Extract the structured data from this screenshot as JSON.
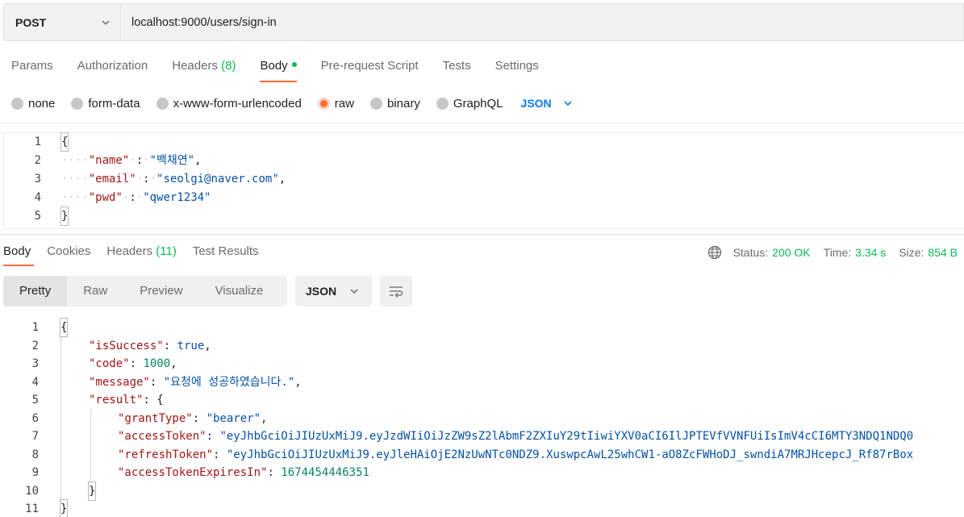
{
  "request": {
    "method": "POST",
    "url": "localhost:9000/users/sign-in"
  },
  "request_tabs": [
    {
      "label": "Params"
    },
    {
      "label": "Authorization"
    },
    {
      "label": "Headers",
      "count": "(8)"
    },
    {
      "label": "Body",
      "active": true
    },
    {
      "label": "Pre-request Script"
    },
    {
      "label": "Tests"
    },
    {
      "label": "Settings"
    }
  ],
  "body_types": [
    {
      "label": "none"
    },
    {
      "label": "form-data"
    },
    {
      "label": "x-www-form-urlencoded"
    },
    {
      "label": "raw",
      "selected": true
    },
    {
      "label": "binary"
    },
    {
      "label": "GraphQL"
    }
  ],
  "body_language": "JSON",
  "request_body": {
    "name_key": "\"name\"",
    "name_val": "\"백채연\"",
    "email_key": "\"email\"",
    "email_val": "\"seolgi@naver.com\"",
    "pwd_key": "\"pwd\"",
    "pwd_val": "\"qwer1234\""
  },
  "response_tabs": [
    {
      "label": "Body",
      "active": true
    },
    {
      "label": "Cookies"
    },
    {
      "label": "Headers",
      "count": "(11)"
    },
    {
      "label": "Test Results"
    }
  ],
  "status": {
    "status_label": "Status:",
    "status_value": "200 OK",
    "time_label": "Time:",
    "time_value": "3.34 s",
    "size_label": "Size:",
    "size_value": "854 B"
  },
  "view_modes": [
    "Pretty",
    "Raw",
    "Preview",
    "Visualize"
  ],
  "response_format": "JSON",
  "response_body": {
    "isSuccess_key": "\"isSuccess\"",
    "isSuccess_val": "true",
    "code_key": "\"code\"",
    "code_val": "1000",
    "message_key": "\"message\"",
    "message_val": "\"요청에 성공하였습니다.\"",
    "result_key": "\"result\"",
    "grantType_key": "\"grantType\"",
    "grantType_val": "\"bearer\"",
    "accessToken_key": "\"accessToken\"",
    "accessToken_val": "\"eyJhbGciOiJIUzUxMiJ9.eyJzdWIiOiJzZW9sZ2lAbmF2ZXIuY29tIiwiYXV0aCI6IlJPTEVfVVNFUiIsImV4cCI6MTY3NDQ1NDQ0",
    "refreshToken_key": "\"refreshToken\"",
    "refreshToken_val": "\"eyJhbGciOiJIUzUxMiJ9.eyJleHAiOjE2NzUwNTc0NDZ9.XuswpcAwL25whCW1-aO8ZcFWHoDJ_swndiA7MRJHcepcJ_Rf87rBox",
    "expires_key": "\"accessTokenExpiresIn\"",
    "expires_val": "1674454446351"
  },
  "colors": {
    "accent": "#ff6c37",
    "success": "#0cbb52",
    "link": "#097bed"
  }
}
